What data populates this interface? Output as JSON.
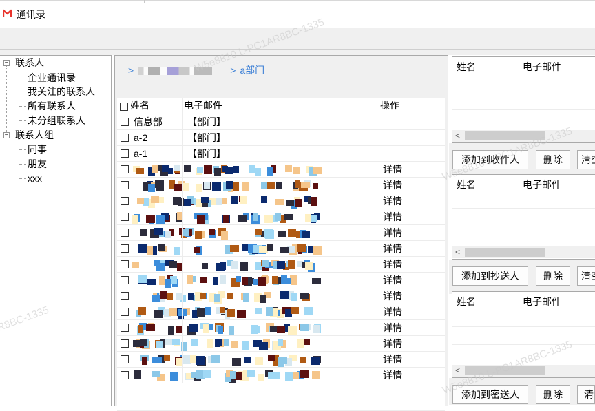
{
  "window": {
    "title": "通讯录",
    "app_icon": "mail-m-icon",
    "accent": "#e8342d"
  },
  "tree": {
    "nodes": [
      {
        "label": "联系人",
        "level": 0,
        "expander": "−"
      },
      {
        "label": "企业通讯录",
        "level": 1
      },
      {
        "label": "我关注的联系人",
        "level": 1
      },
      {
        "label": "所有联系人",
        "level": 1
      },
      {
        "label": "未分组联系人",
        "level": 1
      },
      {
        "label": "联系人组",
        "level": 0,
        "expander": "−"
      },
      {
        "label": "同事",
        "level": 1
      },
      {
        "label": "朋友",
        "level": 1
      },
      {
        "label": "xxx",
        "level": 1
      }
    ]
  },
  "breadcrumb": {
    "sep1": ">",
    "sep2": ">",
    "current": "a部门",
    "link_color": "#3b7fd6"
  },
  "grid": {
    "headers": {
      "name": "姓名",
      "email": "电子邮件",
      "action": "操作"
    },
    "dept_rows": [
      {
        "name": "信息部",
        "email": "【部门】"
      },
      {
        "name": "a-2",
        "email": "【部门】"
      },
      {
        "name": "a-1",
        "email": "【部门】"
      }
    ],
    "detail_label": "详情",
    "contact_row_count_note": "redacted rows"
  },
  "recipients": {
    "headers": {
      "name": "姓名",
      "email": "电子邮件"
    },
    "to_button": "添加到收件人",
    "cc_button": "添加到抄送人",
    "bcc_button": "添加到密送人",
    "delete_button": "删除",
    "clear_button": "清空"
  },
  "watermark": {
    "text": "W5e8810 L-PC1AR8BC-1335"
  }
}
